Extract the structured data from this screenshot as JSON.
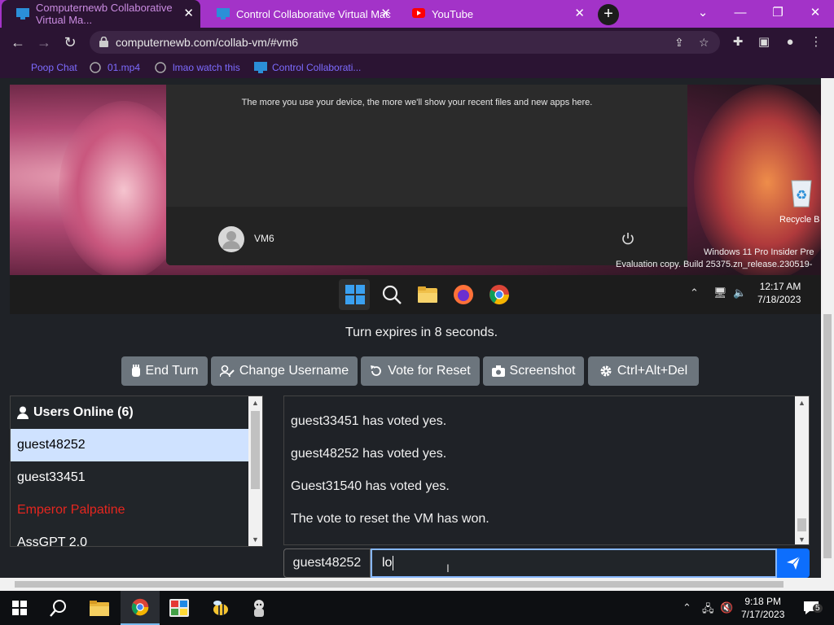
{
  "browser": {
    "tabs": [
      {
        "label": "Computernewb Collaborative Virtual Ma...",
        "active": true
      },
      {
        "label": "Control Collaborative Virtual Mac",
        "active": false
      },
      {
        "label": "YouTube",
        "active": false
      }
    ],
    "url": "computernewb.com/collab-vm/#vm6",
    "bookmarks": [
      "Poop Chat",
      "01.mp4",
      "lmao watch this",
      "Control Collaborati..."
    ],
    "accent_color": "#a333c8"
  },
  "vm": {
    "start_menu_message": "The more you use your device, the more we'll show your recent files and new apps here.",
    "user_name": "VM6",
    "recycle_bin_label": "Recycle B",
    "watermark_line1": "Windows 11 Pro Insider Pre",
    "watermark_line2": "Evaluation copy. Build 25375.zn_release.230519-",
    "clock_time": "12:17 AM",
    "clock_date": "7/18/2023"
  },
  "turn": {
    "text": "Turn expires in 8 seconds."
  },
  "buttons": {
    "end_turn": "End Turn",
    "change_username": "Change Username",
    "vote_reset": "Vote for Reset",
    "screenshot": "Screenshot",
    "ctrl_alt_del": "Ctrl+Alt+Del"
  },
  "users": {
    "header": "Users Online (6)",
    "list": [
      {
        "name": "guest48252",
        "state": "selected"
      },
      {
        "name": "guest33451",
        "state": "normal"
      },
      {
        "name": "Emperor Palpatine",
        "state": "admin"
      },
      {
        "name": "AssGPT 2.0",
        "state": "normal"
      }
    ]
  },
  "chat": {
    "messages": [
      "guest33451 has voted yes.",
      "guest48252 has voted yes.",
      "Guest31540 has voted yes.",
      "The vote to reset the VM has won."
    ],
    "username": "guest48252",
    "input_value": "lo"
  },
  "taskbar": {
    "clock_time": "9:18 PM",
    "clock_date": "7/17/2023",
    "notification_count": "5"
  }
}
